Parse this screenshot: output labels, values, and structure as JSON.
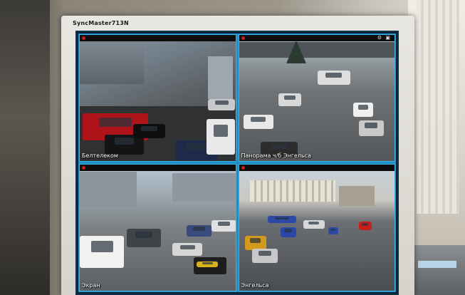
{
  "monitor": {
    "brand": "SyncMaster713N"
  },
  "cameras": [
    {
      "label": "Белтелеком"
    },
    {
      "label": "Панорама ч/б Энгельса"
    },
    {
      "label": "Экран"
    },
    {
      "label": "Энгельса"
    }
  ],
  "colors": {
    "grid_border": "#1d8fc6",
    "record_indicator": "#d01818"
  },
  "icons": {
    "record": "record-dot-icon",
    "camera2_controls": [
      "record-dot-icon",
      "settings-icon",
      "fullscreen-icon"
    ]
  }
}
